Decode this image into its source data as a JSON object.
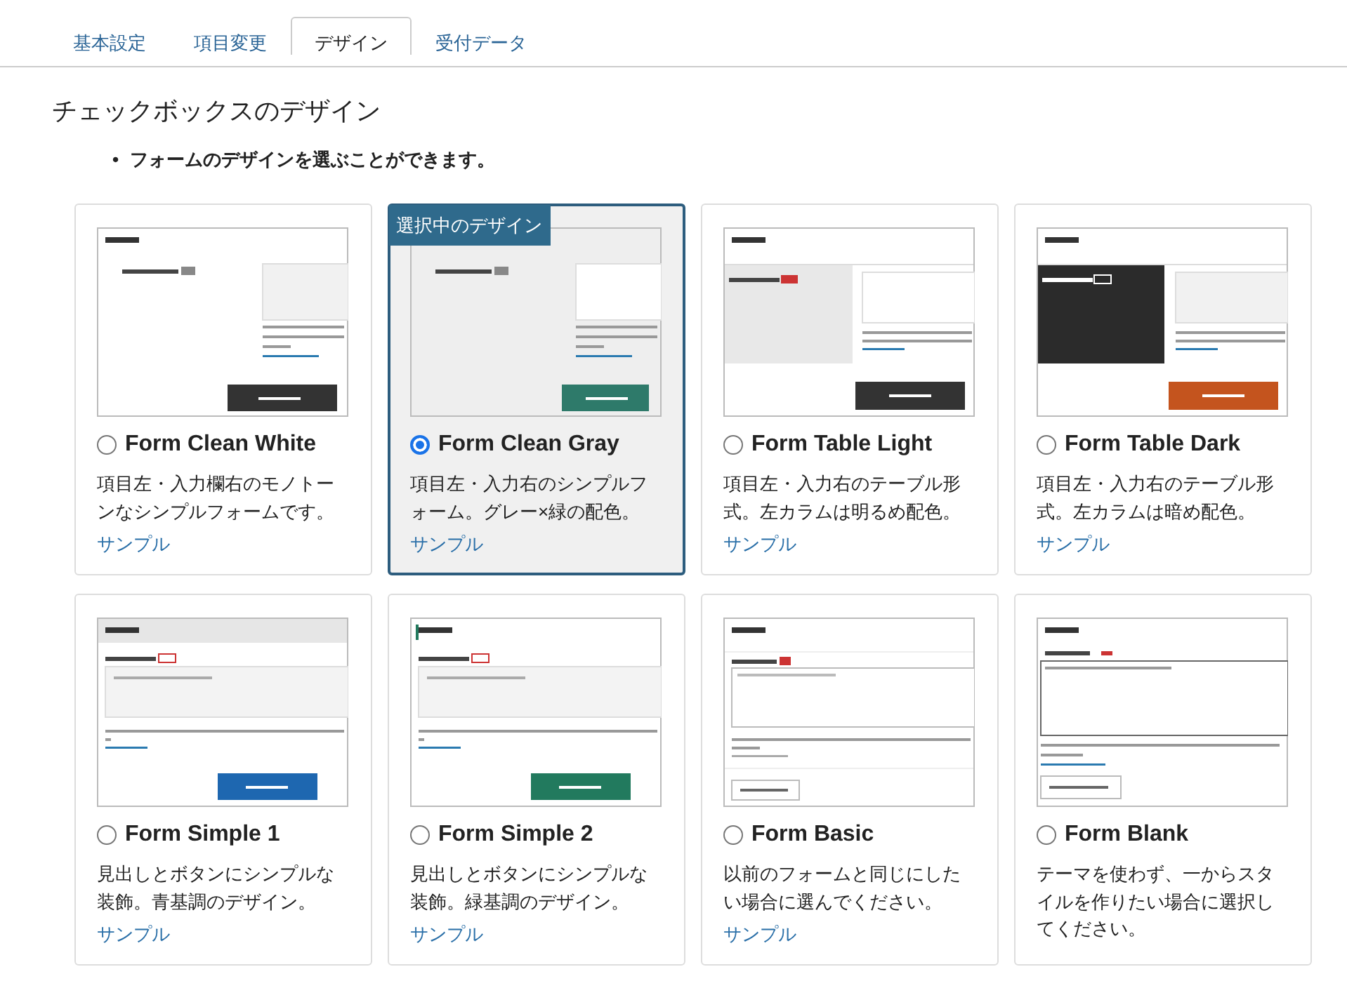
{
  "tabs": [
    {
      "label": "基本設定",
      "selected": false
    },
    {
      "label": "項目変更",
      "selected": false
    },
    {
      "label": "デザイン",
      "selected": true
    },
    {
      "label": "受付データ",
      "selected": false
    }
  ],
  "heading": "チェックボックスのデザイン",
  "bullets": [
    {
      "marker": "•",
      "text": "フォームのデザインを選ぶことができます。"
    }
  ],
  "selected_badge": "選択中のデザイン",
  "designs": [
    {
      "kind": "cleanwhite",
      "name": "Form Clean White",
      "selected": false,
      "description": "項目左・入力欄右のモノトーンなシンプルフォームです。",
      "link": "サンプル"
    },
    {
      "kind": "cleangray",
      "name": "Form Clean Gray",
      "selected": true,
      "description": "項目左・入力右のシンプルフォーム。グレー×緑の配色。",
      "link": "サンプル"
    },
    {
      "kind": "tablelight",
      "name": "Form Table Light",
      "selected": false,
      "description": "項目左・入力右のテーブル形式。左カラムは明るめ配色。",
      "link": "サンプル"
    },
    {
      "kind": "tabledark",
      "name": "Form Table Dark",
      "selected": false,
      "description": "項目左・入力右のテーブル形式。左カラムは暗め配色。",
      "link": "サンプル"
    },
    {
      "kind": "simple1",
      "name": "Form Simple 1",
      "selected": false,
      "description": "見出しとボタンにシンプルな装飾。青基調のデザイン。",
      "link": "サンプル"
    },
    {
      "kind": "simple2",
      "name": "Form Simple 2",
      "selected": false,
      "description": "見出しとボタンにシンプルな装飾。緑基調のデザイン。",
      "link": "サンプル"
    },
    {
      "kind": "basic",
      "name": "Form Basic",
      "selected": false,
      "description": "以前のフォームと同じにしたい場合に選んでください。",
      "link": "サンプル"
    },
    {
      "kind": "blank",
      "name": "Form Blank",
      "selected": false,
      "description": "テーマを使わず、一からスタイルを作りたい場合に選択してください。"
    }
  ]
}
